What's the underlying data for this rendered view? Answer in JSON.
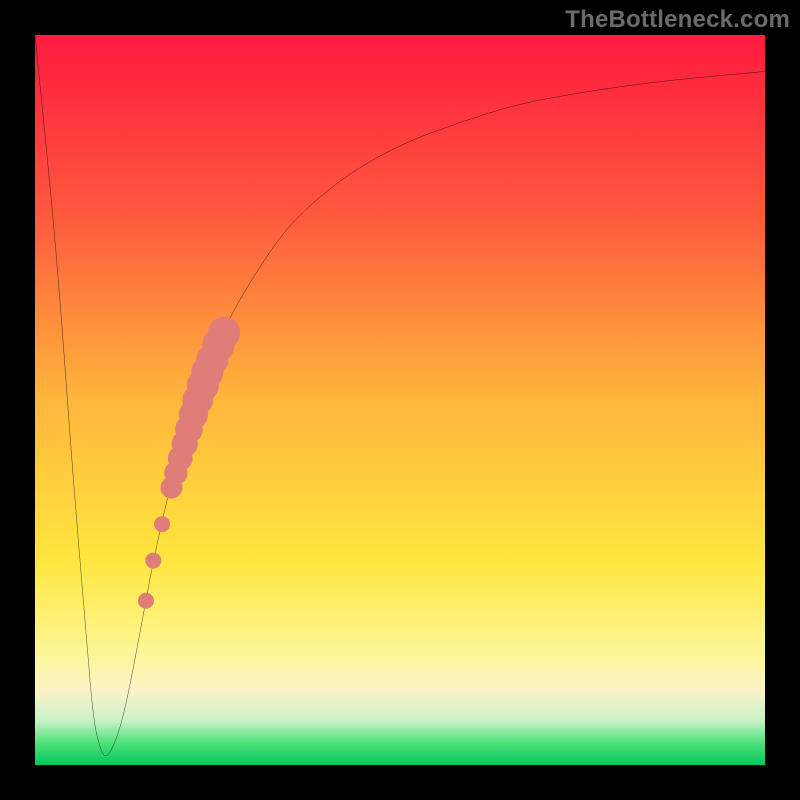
{
  "watermark": {
    "text": "TheBottleneck.com"
  },
  "colors": {
    "frame": "#000000",
    "curve_stroke": "#000000",
    "scatter_fill": "#df7e78",
    "gradient_stops": [
      {
        "offset": 0.0,
        "color": "#ff1a3f"
      },
      {
        "offset": 0.25,
        "color": "#ff5a3d"
      },
      {
        "offset": 0.5,
        "color": "#ffb63c"
      },
      {
        "offset": 0.72,
        "color": "#ffe63f"
      },
      {
        "offset": 0.84,
        "color": "#fdf691"
      },
      {
        "offset": 0.9,
        "color": "#fbf3c9"
      },
      {
        "offset": 0.94,
        "color": "#c6f2c6"
      },
      {
        "offset": 0.97,
        "color": "#4ee07a"
      },
      {
        "offset": 1.0,
        "color": "#00c95a"
      }
    ]
  },
  "chart_data": {
    "type": "line",
    "title": "",
    "xlabel": "",
    "ylabel": "",
    "xlim": [
      0,
      100
    ],
    "ylim": [
      0,
      100
    ],
    "grid": false,
    "legend": false,
    "series": [
      {
        "name": "bottleneck-curve",
        "x": [
          0,
          3,
          5,
          7,
          8,
          9,
          9.7,
          10.5,
          12,
          14,
          16,
          18,
          20,
          22,
          24,
          27,
          30,
          34,
          38,
          43,
          50,
          58,
          66,
          74,
          82,
          90,
          100
        ],
        "y": [
          100,
          70,
          42,
          18,
          6,
          2,
          1,
          2,
          6,
          16,
          27,
          36,
          44,
          50,
          55,
          62,
          67,
          73,
          77,
          81,
          85,
          88,
          90.5,
          92,
          93.2,
          94.1,
          95
        ]
      }
    ],
    "scatter": {
      "name": "highlight-points",
      "points": [
        {
          "x": 15.2,
          "y": 22.5,
          "r": 1.1
        },
        {
          "x": 16.2,
          "y": 28.0,
          "r": 1.1
        },
        {
          "x": 17.4,
          "y": 33.0,
          "r": 1.1
        },
        {
          "x": 18.7,
          "y": 38.0,
          "r": 1.5
        },
        {
          "x": 19.3,
          "y": 40.0,
          "r": 1.6
        },
        {
          "x": 19.9,
          "y": 42.0,
          "r": 1.7
        },
        {
          "x": 20.5,
          "y": 44.0,
          "r": 1.8
        },
        {
          "x": 21.1,
          "y": 46.0,
          "r": 1.9
        },
        {
          "x": 21.7,
          "y": 48.0,
          "r": 2.0
        },
        {
          "x": 22.3,
          "y": 50.0,
          "r": 2.1
        },
        {
          "x": 23.0,
          "y": 52.0,
          "r": 2.2
        },
        {
          "x": 23.6,
          "y": 53.8,
          "r": 2.2
        },
        {
          "x": 24.3,
          "y": 55.5,
          "r": 2.2
        },
        {
          "x": 25.1,
          "y": 57.4,
          "r": 2.2
        },
        {
          "x": 25.9,
          "y": 59.2,
          "r": 2.2
        },
        {
          "x": 24.6,
          "y": 58.0,
          "r": 1.6
        }
      ]
    }
  }
}
